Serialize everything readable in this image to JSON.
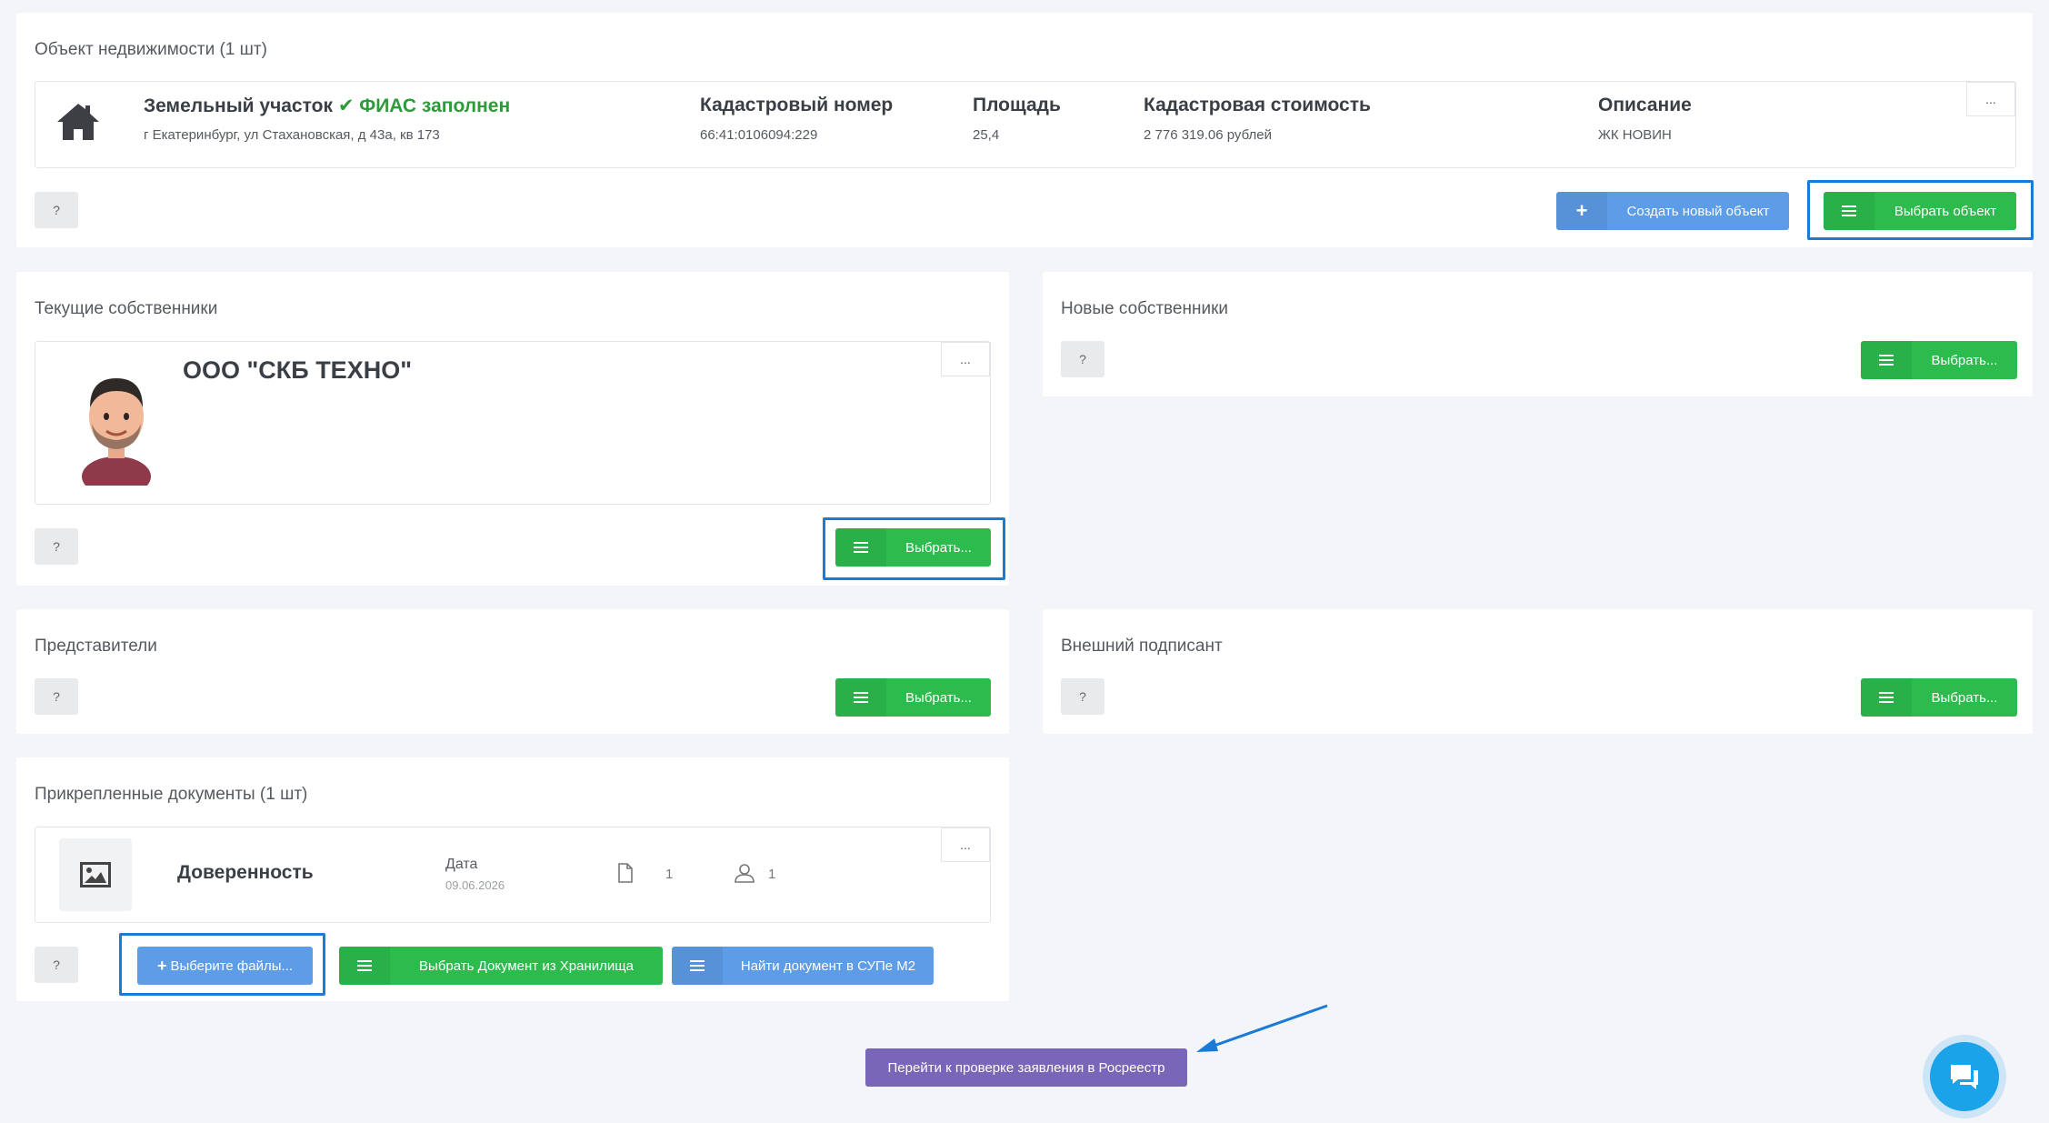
{
  "property": {
    "title": "Объект недвижимости (1 шт)",
    "type": "Земельный участок",
    "fias": "ФИАС заполнен",
    "address": "г Екатеринбург, ул Стахановская, д 43а, кв 173",
    "cadastral_label": "Кадастровый номер",
    "cadastral_value": "66:41:0106094:229",
    "area_label": "Площадь",
    "area_value": "25,4",
    "cost_label": "Кадастровая стоимость",
    "cost_value": "2 776 319.06 рублей",
    "desc_label": "Описание",
    "desc_value": "ЖК НОВИН",
    "dots": "...",
    "help": "?",
    "create_btn": "Создать новый объект",
    "select_btn": "Выбрать объект"
  },
  "current_owners": {
    "title": "Текущие собственники",
    "owner_name": "ООО \"СКБ ТЕХНО\"",
    "dots": "...",
    "help": "?",
    "select_btn": "Выбрать..."
  },
  "new_owners": {
    "title": "Новые собственники",
    "help": "?",
    "select_btn": "Выбрать..."
  },
  "representatives": {
    "title": "Представители",
    "help": "?",
    "select_btn": "Выбрать..."
  },
  "external_signer": {
    "title": "Внешний подписант",
    "help": "?",
    "select_btn": "Выбрать..."
  },
  "documents": {
    "title": "Прикрепленные документы (1 шт)",
    "doc_name": "Доверенность",
    "date_label": "Дата",
    "date_value": "09.06.2026",
    "files_count": "1",
    "persons_count": "1",
    "dots": "...",
    "help": "?",
    "choose_files_btn": "Выберите файлы...",
    "storage_btn": "Выбрать Документ из Хранилища",
    "find_btn": "Найти документ в СУПе М2"
  },
  "footer": {
    "check_btn": "Перейти к проверке заявления в Росреестр"
  },
  "colors": {
    "green": "#2dbb4e",
    "blue": "#5d9ce6",
    "purple": "#7966b8",
    "highlight": "#1a7bd6",
    "fias_green": "#2e9b3a"
  },
  "icons": [
    "home-icon",
    "check-icon",
    "plus-icon",
    "list-icon",
    "avatar",
    "image-icon",
    "file-icon",
    "user-icon",
    "chat-icon",
    "arrow-annotation"
  ]
}
